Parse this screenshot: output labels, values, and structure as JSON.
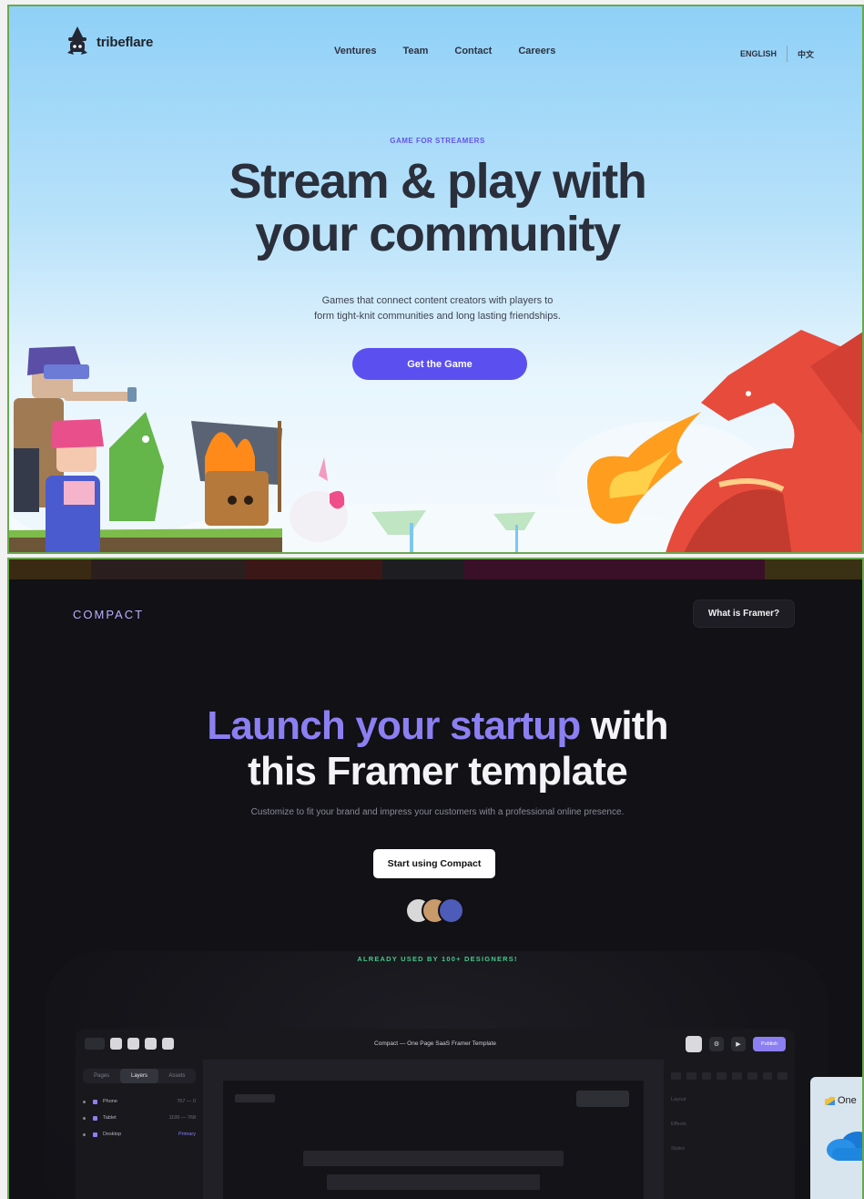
{
  "tribeflare": {
    "brand": "tribeflare",
    "nav": [
      "Ventures",
      "Team",
      "Contact",
      "Careers"
    ],
    "lang": {
      "english": "ENGLISH",
      "chinese": "中文"
    },
    "kicker": "GAME FOR STREAMERS",
    "headline_line1": "Stream & play with",
    "headline_line2": "your community",
    "subtitle_line1": "Games that connect content creators with players to",
    "subtitle_line2": "form tight-knit communities and long lasting friendships.",
    "cta": "Get the Game",
    "colors": {
      "accent": "#5b4ff0",
      "sky": "#8fd0f7",
      "text": "#2a2f3b"
    }
  },
  "compact": {
    "brand": "COMPACT",
    "framer_button": "What is Framer?",
    "headline_accent": "Launch your startup",
    "headline_rest": " with",
    "headline_line2": "this Framer template",
    "subtitle": "Customize to fit your brand and impress your customers with a professional online presence.",
    "cta": "Start using Compact",
    "social_proof": "ALREADY USED BY 100+ DESIGNERS!",
    "colors": {
      "accent": "#8c7ff2",
      "background": "#111116",
      "proof": "#46c98a"
    },
    "editor": {
      "title": "Compact — One Page SaaS Framer Template",
      "publish": "Publish",
      "tabs": [
        "Pages",
        "Layers",
        "Assets"
      ],
      "active_tab": "Layers",
      "layers": [
        {
          "name": "Phone",
          "meta": "767 — 0"
        },
        {
          "name": "Tablet",
          "meta": "1199 — 768"
        },
        {
          "name": "Desktop",
          "meta": "Primary"
        }
      ],
      "props": [
        "Layout",
        "Effects",
        "Styles"
      ]
    }
  },
  "notification": {
    "text": "One"
  }
}
